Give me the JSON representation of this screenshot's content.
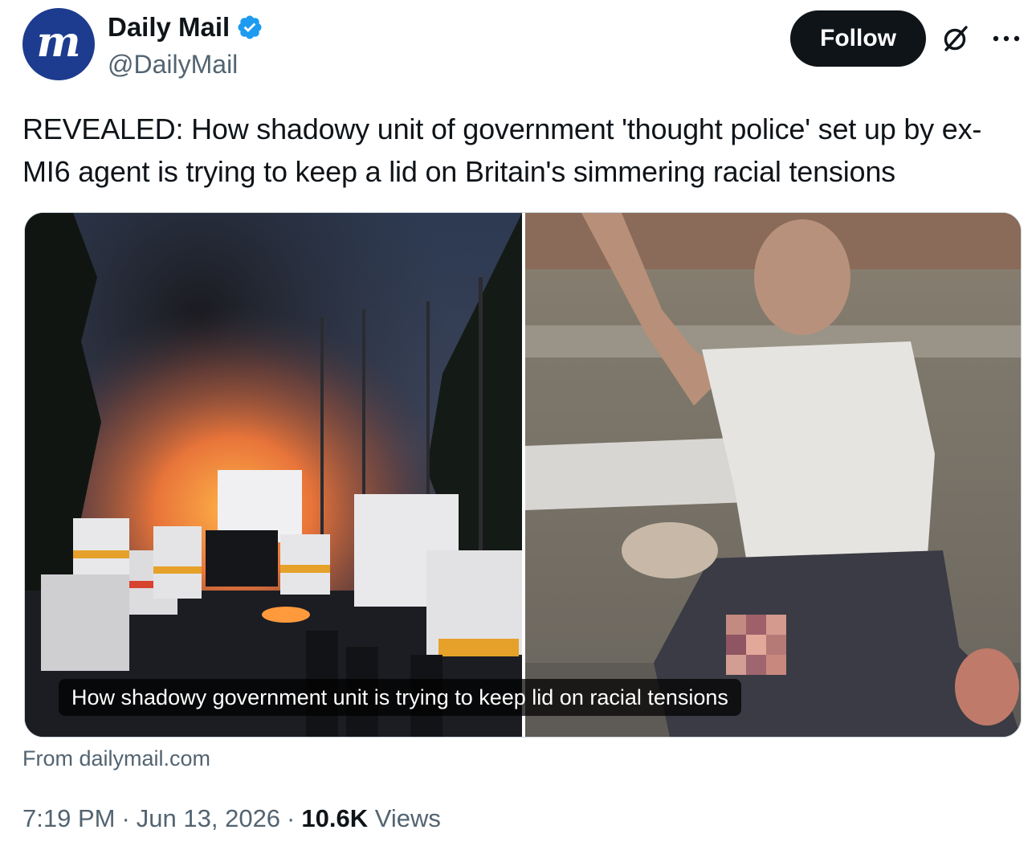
{
  "account": {
    "avatar_text": "m",
    "display_name": "Daily Mail",
    "handle": "@DailyMail",
    "verified_icon": "verified-badge-icon"
  },
  "actions": {
    "follow_label": "Follow",
    "grok_icon": "grok-icon",
    "more_icon": "more-icon"
  },
  "tweet": {
    "text": "REVEALED: How shadowy unit of government 'thought police' set up by ex-MI6 agent is trying to keep a lid on Britain's simmering racial tensions"
  },
  "card": {
    "caption": "How shadowy government unit is trying to keep lid on racial tensions",
    "source": "From dailymail.com"
  },
  "meta": {
    "time": "7:19 PM",
    "date": "Jun 13, 2026",
    "views_count": "10.6K",
    "views_label": "Views"
  },
  "colors": {
    "accent_blue": "#1d9bf0",
    "text_primary": "#0f1419",
    "text_secondary": "#536471",
    "avatar_bg": "#1d3c8f"
  }
}
